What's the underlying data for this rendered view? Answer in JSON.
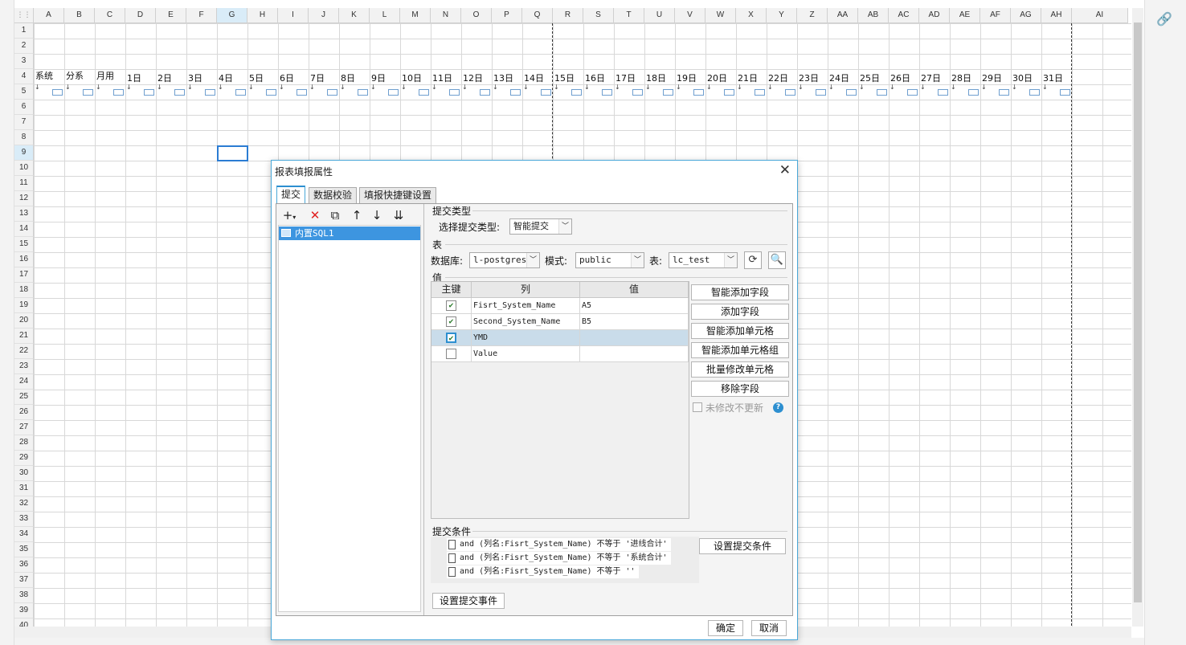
{
  "sheet": {
    "columns": [
      "A",
      "B",
      "C",
      "D",
      "E",
      "F",
      "G",
      "H",
      "I",
      "J",
      "K",
      "L",
      "M",
      "N",
      "O",
      "P",
      "Q",
      "R",
      "S",
      "T",
      "U",
      "V",
      "W",
      "X",
      "Y",
      "Z",
      "AA",
      "AB",
      "AC",
      "AD",
      "AE",
      "AF",
      "AG",
      "AH",
      "AI"
    ],
    "rows": [
      "1",
      "2",
      "3",
      "4",
      "5",
      "6",
      "7",
      "8",
      "9",
      "10",
      "11",
      "12",
      "13",
      "14",
      "15",
      "16",
      "17",
      "18",
      "19",
      "20",
      "21",
      "22",
      "23",
      "24",
      "25",
      "26",
      "27",
      "28",
      "29",
      "30",
      "31",
      "32",
      "33",
      "34",
      "35",
      "36",
      "37",
      "38",
      "39",
      "40"
    ],
    "selected_column": "G",
    "selected_row": "9",
    "row4_headers": [
      "系统",
      "分系",
      "月用",
      "1日",
      "2日",
      "3日",
      "4日",
      "5日",
      "6日",
      "7日",
      "8日",
      "9日",
      "10日",
      "11日",
      "12日",
      "13日",
      "14日",
      "15日",
      "16日",
      "17日",
      "18日",
      "19日",
      "20日",
      "21日",
      "22日",
      "23日",
      "24日",
      "25日",
      "26日",
      "27日",
      "28日",
      "29日",
      "30日",
      "31日"
    ]
  },
  "dialog": {
    "title": "报表填报属性",
    "close_glyph": "✕",
    "tabs": [
      "提交",
      "数据校验",
      "填报快捷键设置"
    ],
    "active_tab": 0,
    "toolbar_icons": [
      "add-icon",
      "delete-icon",
      "copy-icon",
      "arrow-up-icon",
      "arrow-down-icon",
      "sort-icon"
    ],
    "tree_item": "内置SQL1",
    "submit_type_section": "提交类型",
    "submit_type_label": "选择提交类型:",
    "submit_type_value": "智能提交",
    "table_section": "表",
    "db_label": "数据库:",
    "db_value": "l-postgres",
    "schema_label": "模式:",
    "schema_value": "public",
    "table_label": "表:",
    "table_value": "lc_test",
    "value_section": "值",
    "columns": {
      "key": "主键",
      "col": "列",
      "val": "值"
    },
    "rows": [
      {
        "checked": true,
        "column": "Fisrt_System_Name",
        "value": "A5"
      },
      {
        "checked": true,
        "column": "Second_System_Name",
        "value": "B5"
      },
      {
        "checked": true,
        "column": "YMD",
        "value": ""
      },
      {
        "checked": false,
        "column": "Value",
        "value": ""
      }
    ],
    "selected_row": 2,
    "side_buttons": [
      "智能添加字段",
      "添加字段",
      "智能添加单元格",
      "智能添加单元格组",
      "批量修改单元格",
      "移除字段"
    ],
    "no_update_label": "未修改不更新",
    "conditions_section": "提交条件",
    "conditions": [
      "and (列名:Fisrt_System_Name) 不等于 '进线合计'",
      "and (列名:Fisrt_System_Name) 不等于 '系统合计'",
      "and (列名:Fisrt_System_Name) 不等于 ''"
    ],
    "set_condition_button": "设置提交条件",
    "set_event_button": "设置提交事件",
    "ok_button": "确定",
    "cancel_button": "取消"
  }
}
